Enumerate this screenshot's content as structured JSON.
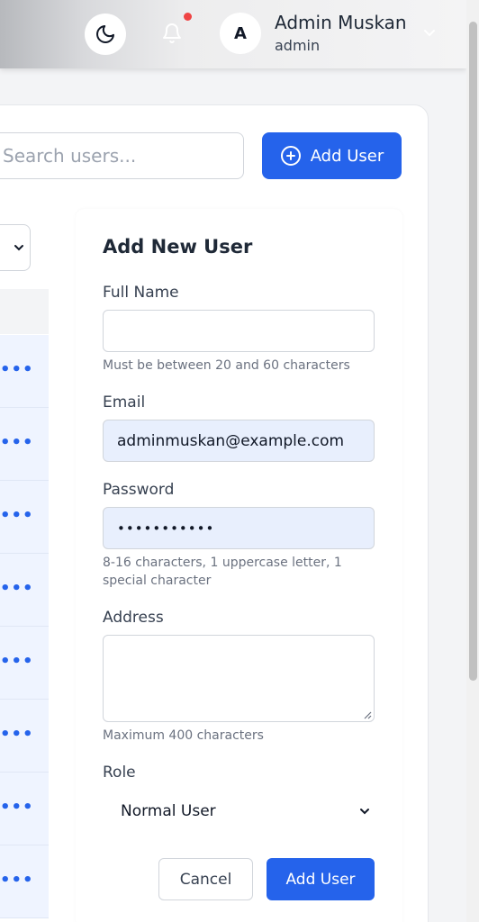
{
  "header": {
    "avatar_initial": "A",
    "user_name": "Admin Muskan",
    "user_role": "admin",
    "icons": [
      "moon-icon",
      "bell-icon",
      "chevron-down-icon"
    ],
    "notification_dot_color": "#ef4444"
  },
  "toolbar": {
    "search_placeholder": "Search users...",
    "add_user_label": "Add User",
    "accent_color": "#2563eb"
  },
  "table": {
    "row_action_label": "•••",
    "visible_rows": 8
  },
  "form": {
    "title": "Add New User",
    "full_name": {
      "label": "Full Name",
      "value": "",
      "hint": "Must be between 20 and 60 characters"
    },
    "email": {
      "label": "Email",
      "value": "adminmuskan@example.com"
    },
    "password": {
      "label": "Password",
      "value": "•••••••••••",
      "hint": "8-16 characters, 1 uppercase letter, 1 special character"
    },
    "address": {
      "label": "Address",
      "value": "",
      "hint": "Maximum 400 characters"
    },
    "role": {
      "label": "Role",
      "value": "Normal User"
    },
    "cancel_label": "Cancel",
    "submit_label": "Add User"
  }
}
